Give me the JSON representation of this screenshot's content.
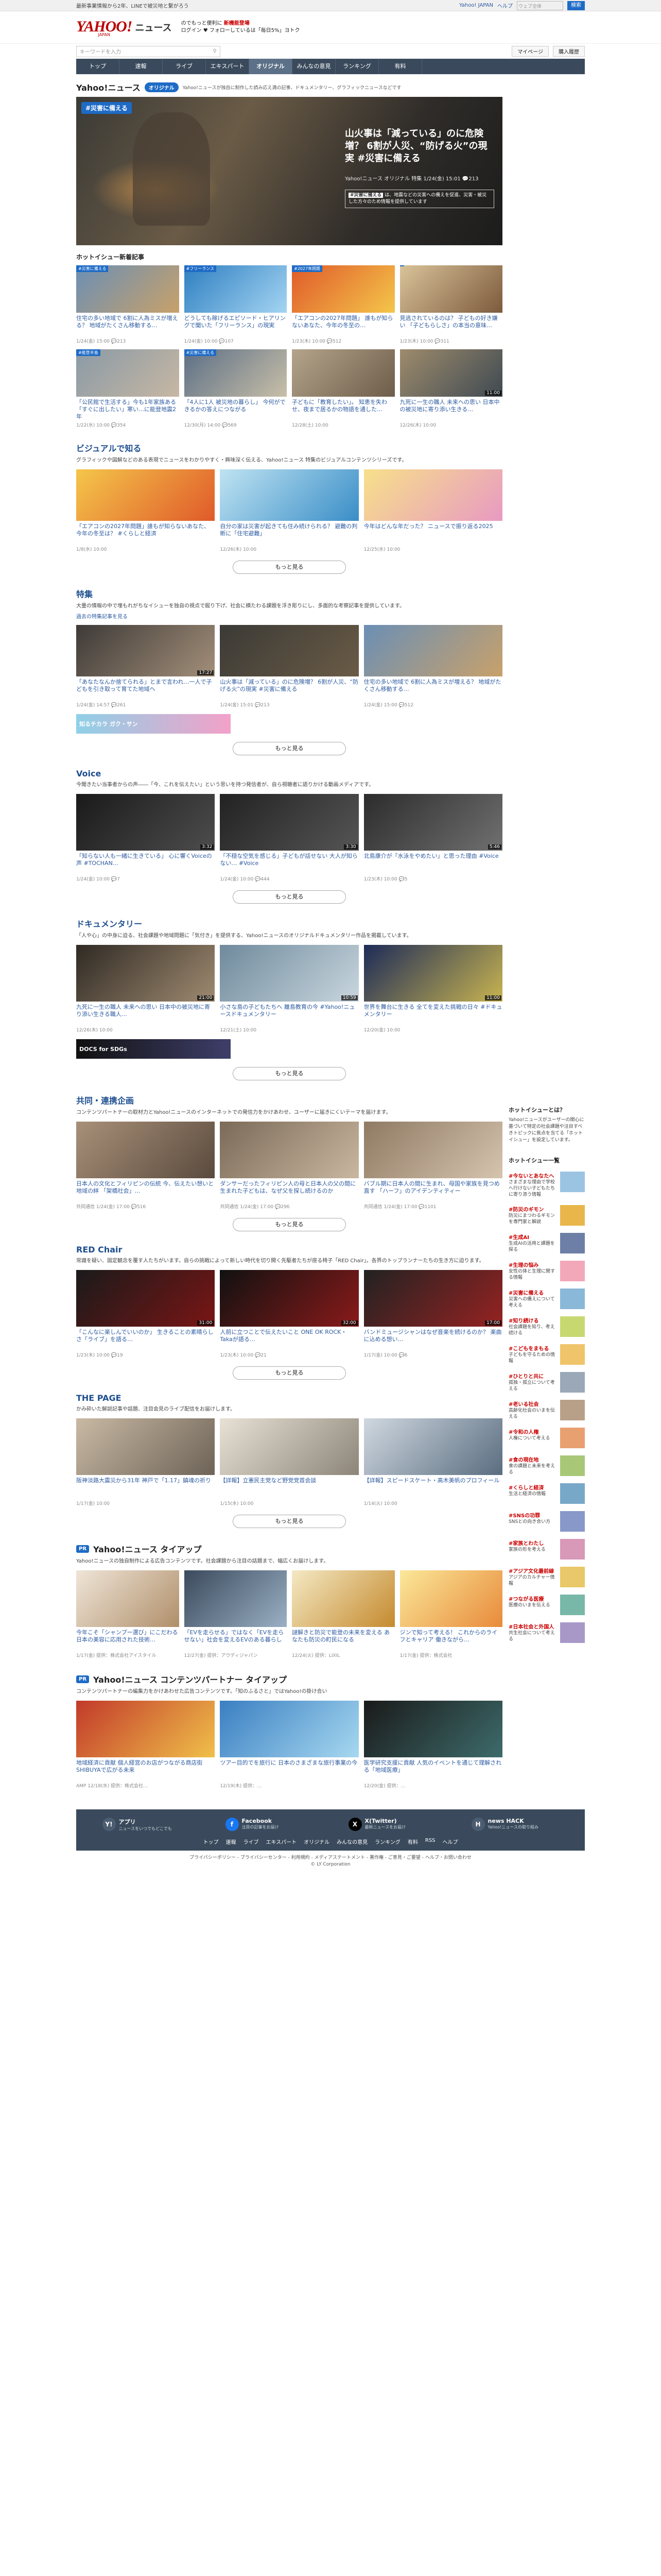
{
  "topbar": {
    "text": "最新事業情報から2年、LINEで被災地と繋がろう",
    "right": [
      "Yahoo! JAPAN",
      "ヘルプ"
    ],
    "search_placeholder": "ウェブ全体",
    "search_btn": "検索"
  },
  "header": {
    "logo": "YAHOO!",
    "logo_sub": "JAPAN",
    "site": "ニュース",
    "msg1": "のでもっと便利に",
    "msg1b": "新機能登場",
    "msg2": "ログイン ♥ フォローしているは「毎日5%」ヨトク"
  },
  "searchrow": {
    "placeholder": "キーワードを入力",
    "links": [
      "マイページ",
      "購入履歴"
    ]
  },
  "nav": [
    "トップ",
    "速報",
    "ライブ",
    "エキスパート",
    "オリジナル",
    "みんなの意見",
    "ランキング",
    "有料"
  ],
  "original": {
    "logo": "Yahoo!ニュース",
    "tag": "オリジナル",
    "desc": "Yahoo!ニュースが独自に制作した読み応え満の記事、ドキュメンタリー、グラフィックニュースなどです"
  },
  "hero": {
    "badge": "#災害に備える",
    "title": "山火事は「減っている」のに危険増？ 6割が人災、“防げる火”の現実 #災害に備える",
    "meta": "Yahoo!ニュース オリジナル 特集 1/24(金) 15:01 💬213",
    "box_tag": "#災害に備える",
    "box": "は、地震などの災害への備えを促進、災害・被災した方々のため情報を提供しています"
  },
  "hot": {
    "title": "ホットイシュー新着記事",
    "items": [
      {
        "label": "#災害に備える",
        "t": "住宅の多い地域で 6割に人為ミスが増える？ 地域がたくさん移動する…",
        "m": "1/24(金) 15:00 💬213"
      },
      {
        "label": "#フリーランス",
        "t": "どうしても稼げるエピソード・ヒアリングで聞いた「フリーランス」の現実",
        "m": "1/24(金) 10:00 💬107"
      },
      {
        "label": "#2027年問題",
        "t": "「エアコンの2027年問題」 誰もが知らないあなた、今年の冬至の…",
        "m": "1/23(木) 10:00 💬512"
      },
      {
        "label": "",
        "t": "見逃されているのは？ 子どもの好き嫌い 「子どもらしさ」の本当の意味…",
        "m": "1/23(木) 10:00 💬311"
      },
      {
        "label": "#能登半島",
        "t": "「公民館で生活する」今も1年家族ある 「すぐに出したい」寒い…に能登地震2年",
        "m": "1/22(水) 10:00 💬354"
      },
      {
        "label": "#災害に備える",
        "t": "「4人に1人 被災地の暮らし」 今何ができるかの答えにつながる",
        "m": "12/30(月) 14:00 💬569"
      },
      {
        "label": "",
        "t": "子どもに「教育したい」。 知恵を失わせ、夜まで居るかの物語を通した…",
        "m": "12/28(土) 10:00"
      },
      {
        "label": "",
        "t": "九死に一生の職人 未来への思い 日本中の被災地に寄り添い生きる…",
        "m": "12/26(木) 10:00",
        "dur": "11:00"
      }
    ]
  },
  "visual": {
    "title": "ビジュアルで知る",
    "desc": "グラフィックや図解などのある表現でニュースをわかりやすく・興味深く伝える、Yahoo!ニュース 特集のビジュアルコンテンツシリーズです。",
    "items": [
      {
        "t": "「エアコンの2027年問題」誰もが知らないあなた、今年の冬至は？ #くらしと経済",
        "m": "1/8(水) 10:00"
      },
      {
        "t": "自分の家は災害が起きても住み続けられる？ 避難の判断に「住宅避難」",
        "m": "12/26(木) 10:00"
      },
      {
        "t": "今年はどんな年だった？ ニュースで振り返る2025",
        "m": "12/25(水) 10:00"
      }
    ],
    "more": "もっと見る"
  },
  "feature": {
    "title": "特集",
    "desc": "大量の情報の中で埋もれがちなイシューを独自の視点で掘り下げ、社会に横たわる課題を浮き彫りにし、多面的な考察記事を提供しています。",
    "link": "過去の特集記事を見る",
    "items": [
      {
        "t": "「あなたなんか捨てられる」とまで言われ…一人で子どもを引き取って育てた地域へ",
        "m": "1/24(金) 14:57 💬261",
        "dur": "17:27"
      },
      {
        "t": "山火事は「減っている」のに危険増？ 6割が人災、“防げる火”の現実 #災害に備える",
        "m": "1/24(金) 15:01 💬213"
      },
      {
        "t": "住宅の多い地域で 6割に人為ミスが増える？ 地域がたくさん移動する…",
        "m": "1/24(金) 15:00 💬512"
      }
    ],
    "banner": "知るチカラ ガク・サン",
    "more": "もっと見る"
  },
  "voice": {
    "title": "Voice",
    "desc": "今聞きたい当事者からの声――「今、これを伝えたい」という思いを持つ発信者が、自ら視聴者に語りかける動画メディアです。",
    "items": [
      {
        "t": "「知らない人も一緒に生きている」 心に響くVoiceの声 #TOCHAN…",
        "m": "1/24(金) 10:00 💬7",
        "dur": "3:32"
      },
      {
        "t": "「不穏な空気を感じる」子どもが話せない 大人が知らない… #Voice",
        "m": "1/24(金) 10:00 💬444",
        "dur": "3:30"
      },
      {
        "t": "北島康介が「水泳をやめたい」と思った理由 #Voice",
        "m": "1/23(木) 10:00 💬5",
        "dur": "5:46"
      }
    ],
    "more": "もっと見る"
  },
  "doc": {
    "title": "ドキュメンタリー",
    "desc": "「人や心」の中身に迫る、社会課題や地域問題に「気付き」を提供する、Yahoo!ニュースのオリジナルドキュメンタリー作品を掲載しています。",
    "items": [
      {
        "t": "九死に一生の職人 未来への思い 日本中の被災地に寄り添い生きる職人…",
        "m": "12/26(木) 10:00",
        "dur": "21:00"
      },
      {
        "t": "小さな島の子どもたちへ 離島教育の今 #Yahoo!ニュースドキュメンタリー",
        "m": "12/21(土) 10:00",
        "dur": "10:59"
      },
      {
        "t": "世界を舞台に生きる 全てを変えた挑戦の日々 #ドキュメンタリー",
        "m": "12/20(金) 10:00",
        "dur": "11:00"
      }
    ],
    "banner": "DOCS for SDGs",
    "more": "もっと見る"
  },
  "collab": {
    "title": "共同・連携企画",
    "desc": "コンテンツパートナーの取材力とYahoo!ニュースのインターネットでの発信力をかけあわせ、ユーザーに届きにくいテーマを届けます。",
    "items": [
      {
        "t": "日本人の文化とフィリピンの伝統 今、伝えたい想いと地域の絆 「架橋社会」…",
        "m": "共同通信 1/24(金) 17:00 💬516"
      },
      {
        "t": "ダンサーだったフィリピン人の母と日本人の父の間に生まれた子どもは、なぜ父を探し続けるのか",
        "m": "共同通信 1/24(金) 17:00 💬296"
      },
      {
        "t": "バブル期に日本人の間に生まれ、母国や家族を見つめ直す 「ハーフ」のアイデンティティー",
        "m": "共同通信 1/24(金) 17:00 💬1101"
      }
    ],
    "more": "もっと見る"
  },
  "red": {
    "title": "RED Chair",
    "desc": "常識を疑い、固定観念を覆す人たちがいます。自らの挑戦によって新しい時代を切り開く先駆者たちが座る椅子「RED Chair」。各界のトップランナーたちの生き方に迫ります。",
    "items": [
      {
        "t": "「こんなに楽しんでいいのか」 生きることの素晴らしさ「ライブ」を語る…",
        "m": "1/23(木) 10:00 💬19",
        "dur": "31:00"
      },
      {
        "t": "人前に立つことで伝えたいこと ONE OK ROCK・Takaが語る…",
        "m": "1/23(木) 10:00 💬21",
        "dur": "32:00"
      },
      {
        "t": "バンドミュージシャンはなぜ音楽を続けるのか？ 楽曲に込める想い…",
        "m": "1/17(金) 10:00 💬6",
        "dur": "17:00"
      }
    ],
    "more": "もっと見る"
  },
  "page": {
    "title": "THE PAGE",
    "desc": "かみ砕いた解説記事や話題、注目会見のライブ配信をお届けします。",
    "items": [
      {
        "t": "阪神淡路大震災から31年 神戸で「1.17」鎮魂の祈り",
        "m": "1/17(金) 10:00"
      },
      {
        "t": "【詳報】立憲民主党など野党党首会談",
        "m": "1/15(水) 10:00"
      },
      {
        "t": "【詳報】スピードスケート・高木美帆のプロフィール",
        "m": "1/14(火) 10:00"
      }
    ],
    "more": "もっと見る"
  },
  "tieup": {
    "pr": "PR",
    "title": "Yahoo!ニュース タイアップ",
    "desc": "Yahoo!ニュースの独自制作による広告コンテンツです。社会課題から注目の話題まで、幅広くお届けします。",
    "items": [
      {
        "t": "今年こそ「シャンプー選び」にこだわる 日本の美容に応用された技術…",
        "m": "1/17(金) 提供：株式会社アイスタイル"
      },
      {
        "t": "「EVを走らせる」ではなく「EVを走らせない」社会を変えるEVのある暮らし",
        "m": "12/27(金) 提供：アウディジャパン"
      },
      {
        "t": "謎解きと防災で能登の未来を変える あなたも防災の町民になる",
        "m": "12/24(火) 提供：LIXIL"
      },
      {
        "t": "ジンで知って考える！ これからのライフとキャリア 働きながら…",
        "m": "1/17(金) 提供：株式会社"
      }
    ]
  },
  "partner": {
    "pr": "PR",
    "title": "Yahoo!ニュース コンテンツパートナー タイアップ",
    "desc": "コンテンツパートナーの編集力をかけあわせた広告コンテンツです。「知のふるさと」ではYahoo!の掛け合い",
    "items": [
      {
        "t": "地域経済に貢献 個人経営のお店がつながる商店街 SHIBUYAで広がる未来",
        "m": "AMP 12/18(水) 提供：株式会社…"
      },
      {
        "t": "ツアー目的でを旅行に 日本のさまざまな旅行事業の今",
        "m": "12/19(木) 提供：…"
      },
      {
        "t": "医学研究支援に貢献 人気のイベントを通じて理解される「地域医療」",
        "m": "12/20(金) 提供：…"
      }
    ]
  },
  "side": {
    "hot_title": "ホットイシューとは？",
    "hot_desc": "Yahoo!ニュースがユーザーの関心に基づいて特定の社会課題や注目すべきトピックに焦点を当てる「ホットイシュー」を設定しています。",
    "list_title": "ホットイシュー一覧",
    "list": [
      {
        "h": "#今ないとあなたへ",
        "d": "さまざまな理由で学校へ行けない子どもたちに寄り添う情報"
      },
      {
        "h": "#防災のギモン",
        "d": "防災にまつわるギモンを専門家と解説"
      },
      {
        "h": "#生成AI",
        "d": "生成AIの活用と課題を探る"
      },
      {
        "h": "#生理の悩み",
        "d": "女性の体と生理に関する情報"
      },
      {
        "h": "#災害に備える",
        "d": "災害への備えについて考える"
      },
      {
        "h": "#知り続ける",
        "d": "社会課題を知り、考え続ける"
      },
      {
        "h": "#こどもをまもる",
        "d": "子どもを守るための情報"
      },
      {
        "h": "#ひとりと共に",
        "d": "孤独・孤立について考える"
      },
      {
        "h": "#老いる社会",
        "d": "高齢化社会のいまを伝える"
      },
      {
        "h": "#令和の人権",
        "d": "人権について考える"
      },
      {
        "h": "#食の現在地",
        "d": "食の課題と未来を考える"
      },
      {
        "h": "#くらしと経済",
        "d": "生活と経済の情報"
      },
      {
        "h": "#SNSの功罪",
        "d": "SNSとの向き合い方"
      },
      {
        "h": "#家族とわたし",
        "d": "家族の形を考える"
      },
      {
        "h": "#アジア文化最前線",
        "d": "アジアのカルチャー情報"
      },
      {
        "h": "#つながる医療",
        "d": "医療のいまを伝える"
      },
      {
        "h": "#日本社会と外国人",
        "d": "共生社会について考える"
      }
    ]
  },
  "footer": {
    "apps": [
      {
        "ic": "Y!",
        "t": "アプリ",
        "d": "ニュースをいつでもどこでも"
      },
      {
        "ic": "f",
        "t": "Facebook",
        "d": "注目の記事をお届け"
      },
      {
        "ic": "X",
        "t": "X(Twitter)",
        "d": "最新ニュースをお届け"
      },
      {
        "ic": "H",
        "t": "news HACK",
        "d": "Yahoo!ニュースの取り組み"
      }
    ],
    "links": [
      "トップ",
      "速報",
      "ライブ",
      "エキスパート",
      "オリジナル",
      "みんなの意見",
      "ランキング",
      "有料",
      "RSS",
      "ヘルプ"
    ],
    "bottom1": "プライバシーポリシー - プライバシーセンター - 利用規約 - メディアステートメント - 著作権 - ご意見・ご要望 - ヘルプ・お問い合わせ",
    "copy": "© LY Corporation"
  }
}
